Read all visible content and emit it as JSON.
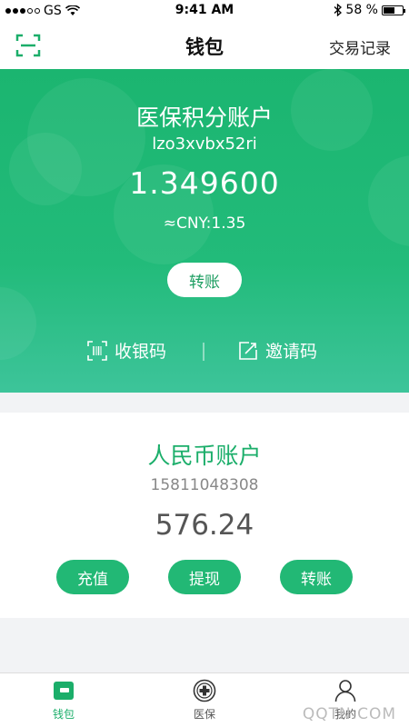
{
  "status_bar": {
    "carrier": "GS",
    "time": "9:41 AM",
    "battery_percent": "58 %",
    "battery_level": 0.58
  },
  "nav": {
    "title": "钱包",
    "right_link": "交易记录"
  },
  "insurance_account": {
    "title": "医保积分账户",
    "account_id": "lzo3xvbx52ri",
    "balance": "1.349600",
    "cny_value": "≈CNY:1.35",
    "transfer_label": "转账",
    "receive_code_label": "收银码",
    "invite_code_label": "邀请码"
  },
  "rmb_account": {
    "title": "人民币账户",
    "phone": "15811048308",
    "balance": "576.24",
    "buttons": [
      "充值",
      "提现",
      "转账"
    ]
  },
  "tabs": [
    {
      "label": "钱包",
      "icon": "wallet-icon",
      "active": true
    },
    {
      "label": "医保",
      "icon": "medical-cross-icon",
      "active": false
    },
    {
      "label": "我的",
      "icon": "person-icon",
      "active": false
    }
  ],
  "colors": {
    "brand_green": "#1bb570",
    "rmb_green": "#1bae6a"
  },
  "watermark": "QQTN.COM"
}
